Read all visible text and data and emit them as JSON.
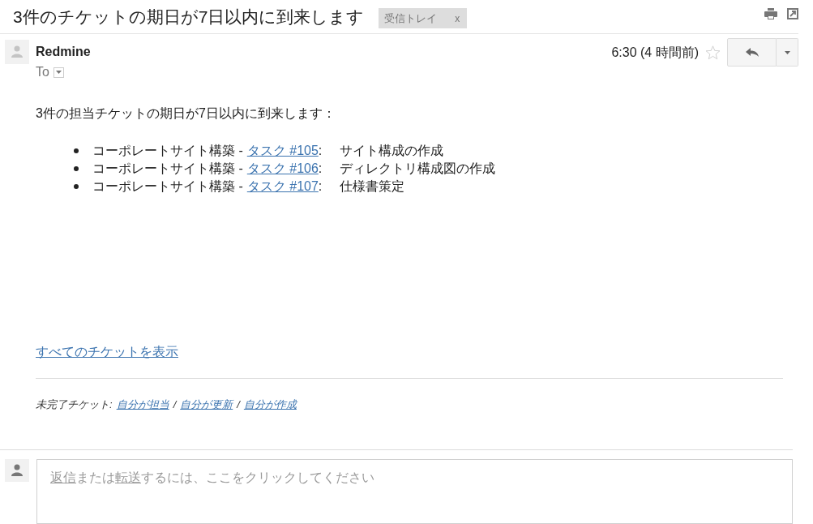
{
  "header": {
    "subject": "3件のチケットの期日が7日以内に到来します",
    "labels": [
      {
        "text": "受信トレイ",
        "remove": "x"
      }
    ]
  },
  "message": {
    "sender": "Redmine",
    "recipient": "To",
    "time": "6:30 (4 時間前)",
    "starred": false
  },
  "body": {
    "intro": "3件の担当チケットの期日が7日以内に到来します：",
    "tickets": [
      {
        "project": "コーポレートサイト構築 -",
        "task": "タスク #105",
        "task_suffix": ":",
        "subject": "サイト構成の作成"
      },
      {
        "project": "コーポレートサイト構築 -",
        "task": "タスク #106",
        "task_suffix": ":",
        "subject": "ディレクトリ構成図の作成"
      },
      {
        "project": "コーポレートサイト構築 -",
        "task": "タスク #107",
        "task_suffix": ":",
        "subject": "仕様書策定"
      }
    ],
    "all_tickets_link": "すべてのチケットを表示",
    "footer": [
      {
        "kind": "text",
        "text": "未完了チケット:"
      },
      {
        "kind": "link",
        "text": "自分が担当"
      },
      {
        "kind": "text",
        "text": "/"
      },
      {
        "kind": "link",
        "text": "自分が更新"
      },
      {
        "kind": "text",
        "text": "/"
      },
      {
        "kind": "link",
        "text": "自分が作成"
      }
    ]
  },
  "reply_box": {
    "prompt": [
      {
        "kind": "link",
        "text": "返信"
      },
      {
        "kind": "text",
        "text": "または"
      },
      {
        "kind": "link",
        "text": "転送"
      },
      {
        "kind": "text",
        "text": "するには、ここをクリックしてください"
      }
    ]
  }
}
